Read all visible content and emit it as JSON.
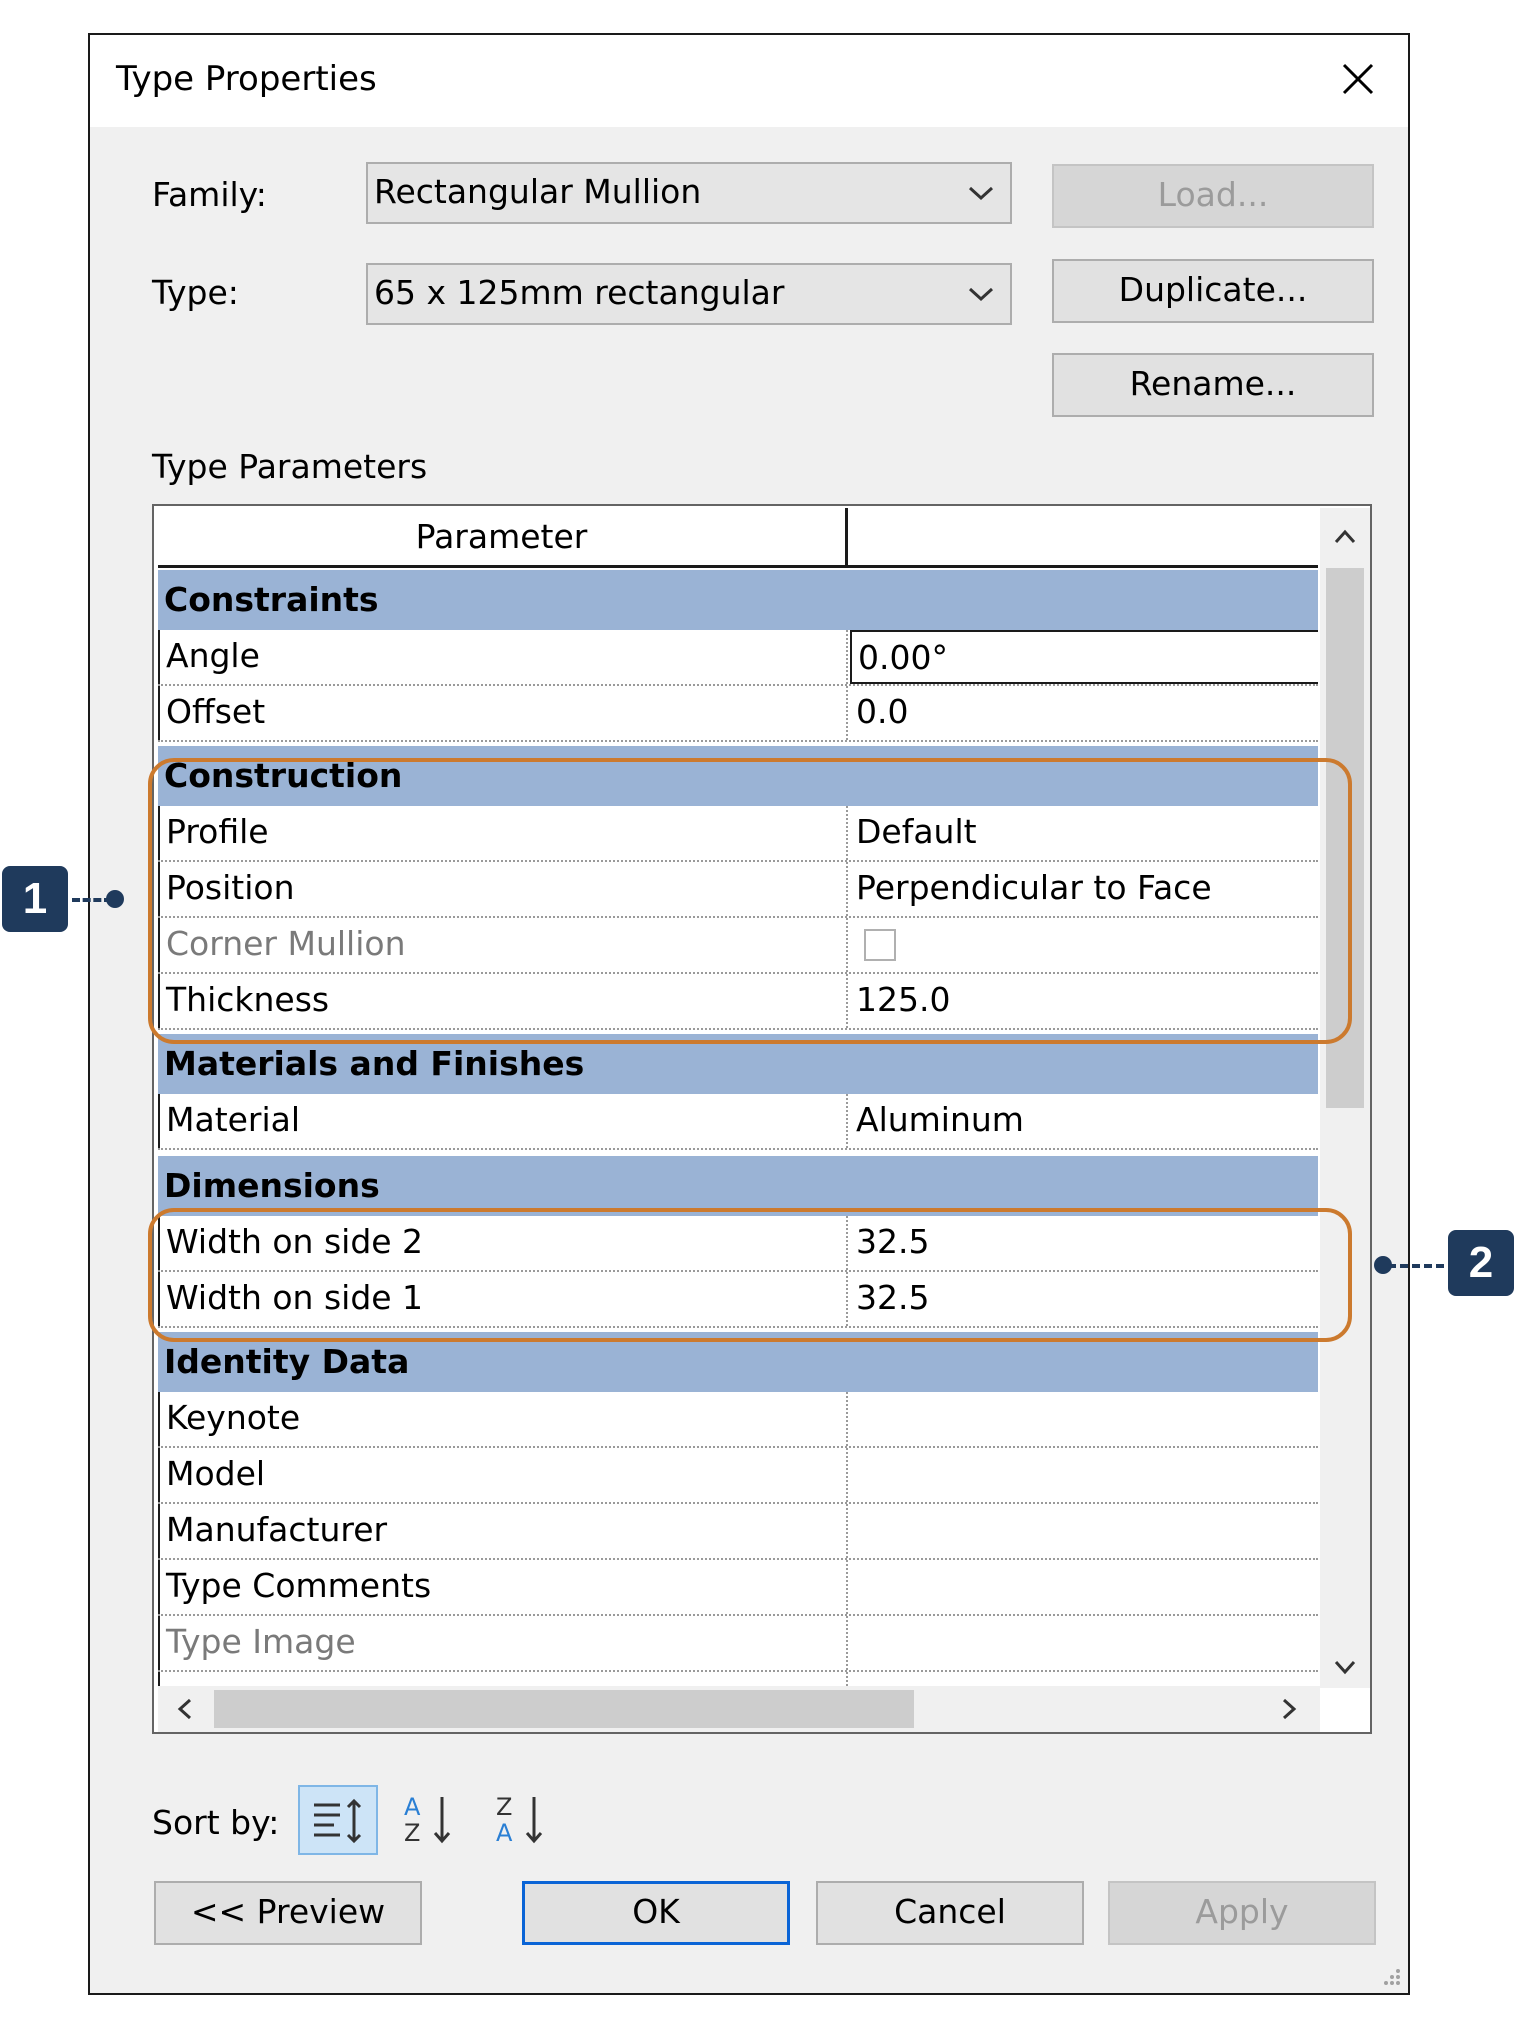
{
  "dialog": {
    "title": "Type Properties",
    "family_label": "Family:",
    "family_value": "Rectangular Mullion",
    "type_label": "Type:",
    "type_value": "65 x 125mm rectangular",
    "load_label": "Load...",
    "duplicate_label": "Duplicate...",
    "rename_label": "Rename...",
    "type_parameters_label": "Type Parameters"
  },
  "grid": {
    "header_parameter": "Parameter",
    "header_value": "",
    "groups": [
      {
        "name": "Constraints",
        "rows": [
          {
            "name": "Angle",
            "value": "0.00°"
          },
          {
            "name": "Offset",
            "value": "0.0"
          }
        ]
      },
      {
        "name": "Construction",
        "rows": [
          {
            "name": "Profile",
            "value": "Default"
          },
          {
            "name": "Position",
            "value": "Perpendicular to Face"
          },
          {
            "name": "Corner Mullion",
            "value": ""
          },
          {
            "name": "Thickness",
            "value": "125.0"
          }
        ]
      },
      {
        "name": "Materials and Finishes",
        "rows": [
          {
            "name": "Material",
            "value": "Aluminum"
          }
        ]
      },
      {
        "name": "Dimensions",
        "rows": [
          {
            "name": "Width on side 2",
            "value": "32.5"
          },
          {
            "name": "Width on side 1",
            "value": "32.5"
          }
        ]
      },
      {
        "name": "Identity Data",
        "rows": [
          {
            "name": "Keynote",
            "value": ""
          },
          {
            "name": "Model",
            "value": ""
          },
          {
            "name": "Manufacturer",
            "value": ""
          },
          {
            "name": "Type Comments",
            "value": ""
          },
          {
            "name": "Type Image",
            "value": ""
          }
        ]
      }
    ]
  },
  "sort": {
    "label": "Sort by:"
  },
  "footer": {
    "preview_label": "<< Preview",
    "ok_label": "OK",
    "cancel_label": "Cancel",
    "apply_label": "Apply"
  },
  "callouts": [
    "1",
    "2"
  ],
  "colors": {
    "accent": "#cc7a2e",
    "callout": "#1f3a5c",
    "category": "#9ab3d5"
  }
}
